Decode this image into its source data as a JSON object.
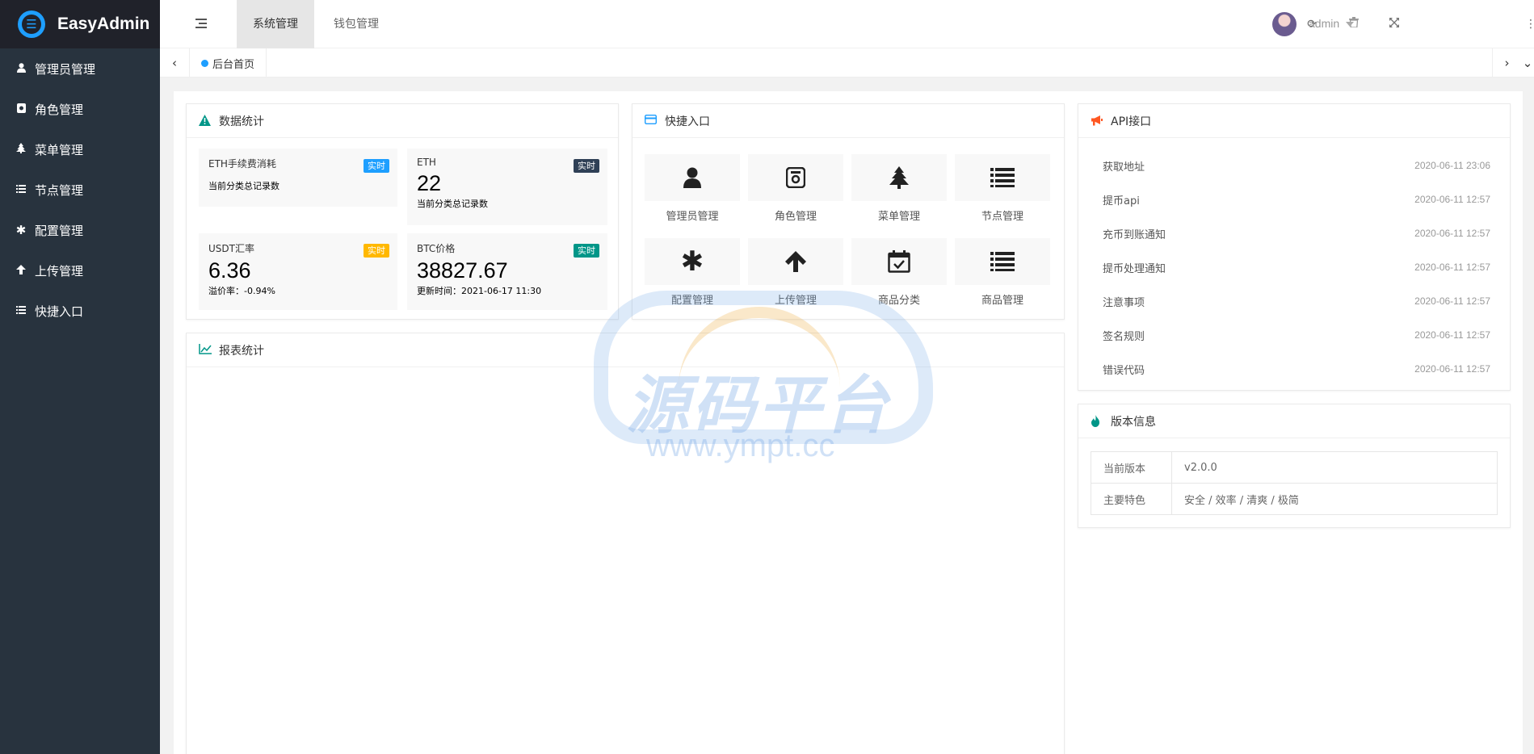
{
  "app": {
    "title": "EasyAdmin"
  },
  "sidebar": {
    "items": [
      {
        "label": "管理员管理",
        "icon": "user-icon"
      },
      {
        "label": "角色管理",
        "icon": "role-icon"
      },
      {
        "label": "菜单管理",
        "icon": "tree-icon"
      },
      {
        "label": "节点管理",
        "icon": "list-icon"
      },
      {
        "label": "配置管理",
        "icon": "asterisk-icon"
      },
      {
        "label": "上传管理",
        "icon": "arrow-up-icon"
      },
      {
        "label": "快捷入口",
        "icon": "list-icon"
      }
    ]
  },
  "header": {
    "tabs": [
      {
        "label": "系统管理",
        "active": true
      },
      {
        "label": "钱包管理",
        "active": false
      }
    ],
    "username": "admin"
  },
  "tabstrip": {
    "current": "后台首页"
  },
  "stats": {
    "title": "数据统计",
    "boxes": [
      {
        "title": "ETH手续费消耗",
        "badge": "实时",
        "badge_color": "#1e9fff",
        "value": "",
        "desc": "当前分类总记录数"
      },
      {
        "title": "ETH",
        "badge": "实时",
        "badge_color": "#2f4056",
        "value": "22",
        "desc": "当前分类总记录数"
      },
      {
        "title": "USDT汇率",
        "badge": "实时",
        "badge_color": "#ffb800",
        "value": "6.36",
        "desc": "溢价率：-0.94%"
      },
      {
        "title": "BTC价格",
        "badge": "实时",
        "badge_color": "#009688",
        "value": "38827.67",
        "desc": "更新时间：2021-06-17 11:30"
      }
    ]
  },
  "quick": {
    "title": "快捷入口",
    "items": [
      {
        "label": "管理员管理",
        "icon": "user-icon"
      },
      {
        "label": "角色管理",
        "icon": "role-icon"
      },
      {
        "label": "菜单管理",
        "icon": "tree-icon"
      },
      {
        "label": "节点管理",
        "icon": "list-icon"
      },
      {
        "label": "配置管理",
        "icon": "asterisk-icon"
      },
      {
        "label": "上传管理",
        "icon": "arrow-up-icon"
      },
      {
        "label": "商品分类",
        "icon": "calendar-check-icon"
      },
      {
        "label": "商品管理",
        "icon": "list-icon"
      }
    ]
  },
  "report": {
    "title": "报表统计"
  },
  "api": {
    "title": "API接口",
    "rows": [
      {
        "name": "获取地址",
        "date": "2020-06-11 23:06"
      },
      {
        "name": "提币api",
        "date": "2020-06-11 12:57"
      },
      {
        "name": "充币到账通知",
        "date": "2020-06-11 12:57"
      },
      {
        "name": "提币处理通知",
        "date": "2020-06-11 12:57"
      },
      {
        "name": "注意事项",
        "date": "2020-06-11 12:57"
      },
      {
        "name": "签名规则",
        "date": "2020-06-11 12:57"
      },
      {
        "name": "错误代码",
        "date": "2020-06-11 12:57"
      }
    ]
  },
  "version": {
    "title": "版本信息",
    "rows": [
      {
        "key": "当前版本",
        "value": "v2.0.0"
      },
      {
        "key": "主要特色",
        "value": "安全 / 效率 / 清爽 / 极简"
      }
    ]
  },
  "watermark": {
    "text": "源码平台",
    "url": "www.ympt.cc"
  }
}
